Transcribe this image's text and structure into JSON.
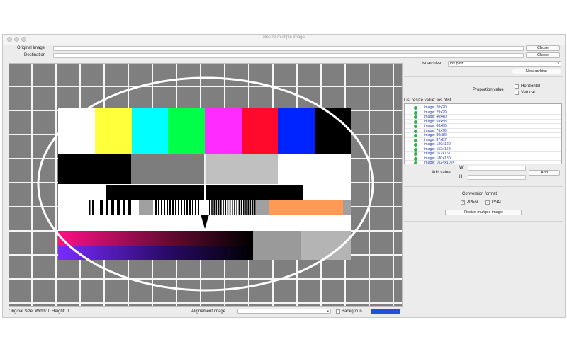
{
  "window": {
    "title": "Resize multiple image"
  },
  "form": {
    "original_label": "Original Image",
    "destination_label": "Destination",
    "chose1": "Chose",
    "chose2": "Chose"
  },
  "right": {
    "list_archive_label": "List archive",
    "list_archive_value": "ios.plist",
    "new_archive": "New archive",
    "proportion_label": "Proportion value",
    "horizontal": "Horizontal",
    "vertical": "Vertical",
    "list_resize_label": "List resize value: ios.plist",
    "items": [
      "image: 20x20",
      "image: 29x29",
      "image: 40x40",
      "image: 58x58",
      "image: 60x60",
      "image: 76x76",
      "image: 80x80",
      "image: 87x87",
      "image: 120x120",
      "image: 152x152",
      "image: 167x167",
      "image: 180x180",
      "image: 1024x1024"
    ],
    "w_label": "W",
    "h_label": "H",
    "add_value_label": "Add value",
    "add_button": "Add",
    "conversion_label": "Conversion format",
    "jpeg": "JPEG",
    "png": "PNG",
    "check_mark": "✓",
    "resize_button": "Resize multiple image"
  },
  "bottom": {
    "size_text": "Original Size: Width: 0 Height: 0",
    "alignment_label": "Alignement image",
    "background_label": "Backgroun",
    "background_color": "#1f53d6"
  },
  "colors": {
    "bar_white": "#ffffff",
    "bar_yellow": "#ffff3b",
    "bar_cyan": "#00ffff",
    "bar_green": "#00ff49",
    "bar_magenta": "#ff2bff",
    "bar_red": "#ff0a2c",
    "bar_blue": "#0024ff",
    "bar_black": "#000000",
    "grid_cell": "#7f7f7f",
    "orange": "#ff9a55",
    "select_dot": "#31b34a"
  }
}
